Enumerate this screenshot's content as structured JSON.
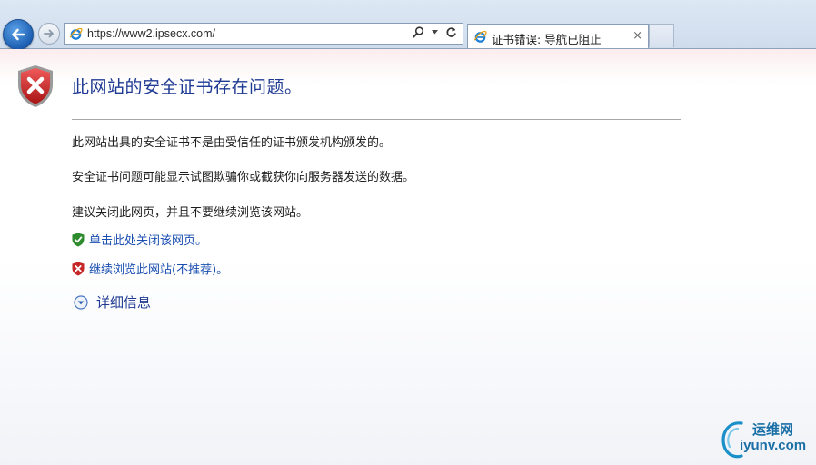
{
  "browser": {
    "url": "https://www2.ipsecx.com/",
    "tab_title": "证书错误: 导航已阻止",
    "tab_close": "×"
  },
  "error_page": {
    "heading": "此网站的安全证书存在问题。",
    "paragraphs": [
      "此网站出具的安全证书不是由受信任的证书颁发机构颁发的。",
      "安全证书问题可能显示试图欺骗你或截获你向服务器发送的数据。",
      "建议关闭此网页，并且不要继续浏览该网站。"
    ],
    "links": {
      "close_page": "单击此处关闭该网页。",
      "continue": "继续浏览此网站(不推荐)。"
    },
    "more_info": "详细信息"
  },
  "watermark": {
    "cn": "运维网",
    "en": "iyunv.com"
  },
  "icons": {
    "back": "back-arrow-icon",
    "forward": "forward-arrow-icon",
    "ie": "ie-logo-icon",
    "search": "search-icon",
    "refresh": "refresh-icon",
    "shield_error": "shield-error-icon",
    "shield_ok": "shield-check-icon",
    "expand": "chevron-down-circle-icon"
  },
  "colors": {
    "heading": "#1f3a93",
    "link": "#1a4fb0",
    "shield_red": "#c62828",
    "shield_green": "#2e8b2e"
  }
}
